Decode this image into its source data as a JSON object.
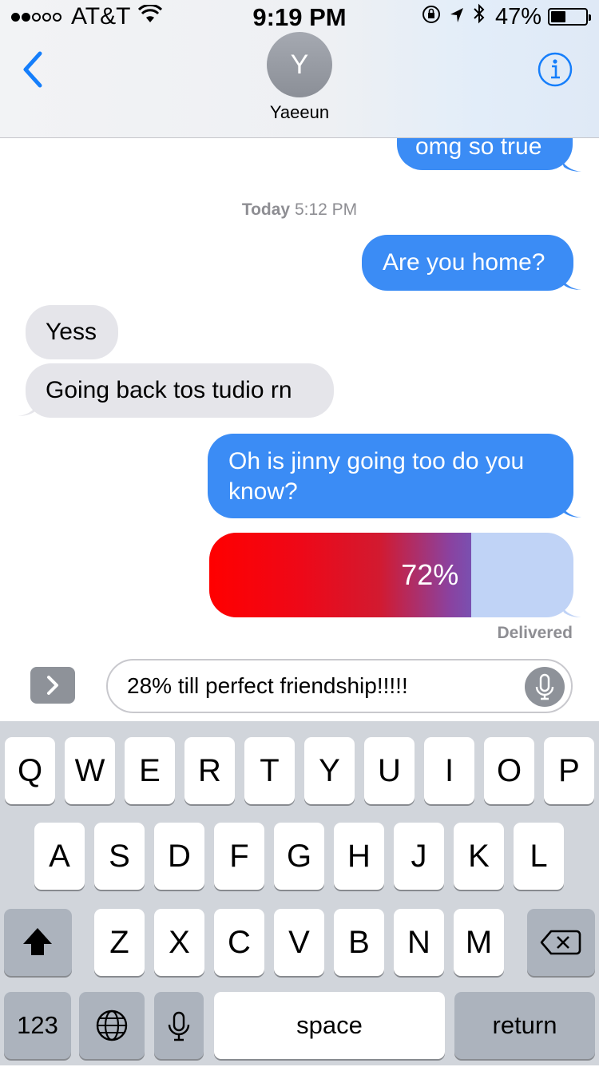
{
  "status_bar": {
    "carrier": "AT&T",
    "time": "9:19 PM",
    "battery_percent": "47%",
    "battery_level": 0.47,
    "signal_bars": 2,
    "icons": [
      "wifi-icon",
      "orientation-lock-icon",
      "location-icon",
      "bluetooth-icon",
      "battery-icon"
    ]
  },
  "header": {
    "back_icon": "chevron-left-icon",
    "avatar_initial": "Y",
    "contact_name": "Yaeeun",
    "info_icon": "info-icon"
  },
  "thread": {
    "timestamp_day": "Today",
    "timestamp_time": "5:12 PM",
    "messages": [
      {
        "from": "me",
        "text": "omg so true"
      },
      {
        "from": "me",
        "text": "Are you home?"
      },
      {
        "from": "them",
        "text": "Yess"
      },
      {
        "from": "them",
        "text": "Going back tos tudio rn"
      },
      {
        "from": "me",
        "text": "Oh is jinny going too do you know?"
      }
    ],
    "progress_message": {
      "label": "72%",
      "value": 0.72
    },
    "delivered": "Delivered"
  },
  "input": {
    "value": "28% till perfect friendship!!!!!",
    "apps_icon": "chevron-right-icon",
    "mic_icon": "microphone-icon"
  },
  "keyboard": {
    "row1": [
      "Q",
      "W",
      "E",
      "R",
      "T",
      "Y",
      "U",
      "I",
      "O",
      "P"
    ],
    "row2": [
      "A",
      "S",
      "D",
      "F",
      "G",
      "H",
      "J",
      "K",
      "L"
    ],
    "row3": [
      "Z",
      "X",
      "C",
      "V",
      "B",
      "N",
      "M"
    ],
    "shift_icon": "shift-icon",
    "delete_icon": "backspace-icon",
    "numbers": "123",
    "globe_icon": "globe-icon",
    "dictation_icon": "microphone-icon",
    "space": "space",
    "return": "return"
  },
  "colors": {
    "sent_bubble": "#3b8cf5",
    "received_bubble": "#e5e5ea",
    "ios_blue": "#157efb",
    "keyboard_bg": "#d1d5db"
  }
}
